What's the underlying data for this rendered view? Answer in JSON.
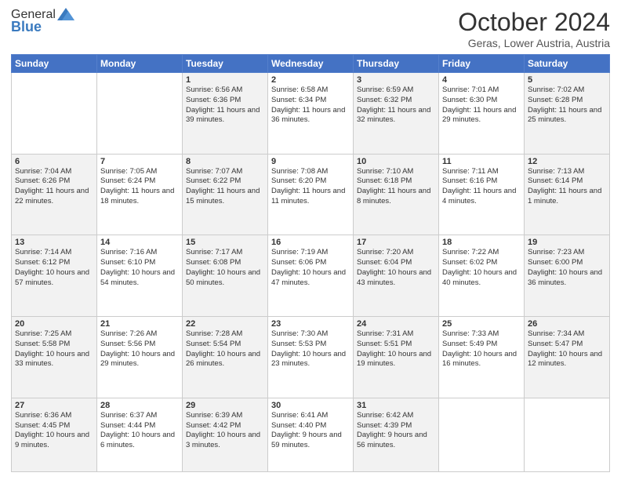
{
  "logo": {
    "general": "General",
    "blue": "Blue"
  },
  "header": {
    "month": "October 2024",
    "location": "Geras, Lower Austria, Austria"
  },
  "days_of_week": [
    "Sunday",
    "Monday",
    "Tuesday",
    "Wednesday",
    "Thursday",
    "Friday",
    "Saturday"
  ],
  "weeks": [
    [
      {
        "day": "",
        "info": ""
      },
      {
        "day": "",
        "info": ""
      },
      {
        "day": "1",
        "info": "Sunrise: 6:56 AM\nSunset: 6:36 PM\nDaylight: 11 hours and 39 minutes."
      },
      {
        "day": "2",
        "info": "Sunrise: 6:58 AM\nSunset: 6:34 PM\nDaylight: 11 hours and 36 minutes."
      },
      {
        "day": "3",
        "info": "Sunrise: 6:59 AM\nSunset: 6:32 PM\nDaylight: 11 hours and 32 minutes."
      },
      {
        "day": "4",
        "info": "Sunrise: 7:01 AM\nSunset: 6:30 PM\nDaylight: 11 hours and 29 minutes."
      },
      {
        "day": "5",
        "info": "Sunrise: 7:02 AM\nSunset: 6:28 PM\nDaylight: 11 hours and 25 minutes."
      }
    ],
    [
      {
        "day": "6",
        "info": "Sunrise: 7:04 AM\nSunset: 6:26 PM\nDaylight: 11 hours and 22 minutes."
      },
      {
        "day": "7",
        "info": "Sunrise: 7:05 AM\nSunset: 6:24 PM\nDaylight: 11 hours and 18 minutes."
      },
      {
        "day": "8",
        "info": "Sunrise: 7:07 AM\nSunset: 6:22 PM\nDaylight: 11 hours and 15 minutes."
      },
      {
        "day": "9",
        "info": "Sunrise: 7:08 AM\nSunset: 6:20 PM\nDaylight: 11 hours and 11 minutes."
      },
      {
        "day": "10",
        "info": "Sunrise: 7:10 AM\nSunset: 6:18 PM\nDaylight: 11 hours and 8 minutes."
      },
      {
        "day": "11",
        "info": "Sunrise: 7:11 AM\nSunset: 6:16 PM\nDaylight: 11 hours and 4 minutes."
      },
      {
        "day": "12",
        "info": "Sunrise: 7:13 AM\nSunset: 6:14 PM\nDaylight: 11 hours and 1 minute."
      }
    ],
    [
      {
        "day": "13",
        "info": "Sunrise: 7:14 AM\nSunset: 6:12 PM\nDaylight: 10 hours and 57 minutes."
      },
      {
        "day": "14",
        "info": "Sunrise: 7:16 AM\nSunset: 6:10 PM\nDaylight: 10 hours and 54 minutes."
      },
      {
        "day": "15",
        "info": "Sunrise: 7:17 AM\nSunset: 6:08 PM\nDaylight: 10 hours and 50 minutes."
      },
      {
        "day": "16",
        "info": "Sunrise: 7:19 AM\nSunset: 6:06 PM\nDaylight: 10 hours and 47 minutes."
      },
      {
        "day": "17",
        "info": "Sunrise: 7:20 AM\nSunset: 6:04 PM\nDaylight: 10 hours and 43 minutes."
      },
      {
        "day": "18",
        "info": "Sunrise: 7:22 AM\nSunset: 6:02 PM\nDaylight: 10 hours and 40 minutes."
      },
      {
        "day": "19",
        "info": "Sunrise: 7:23 AM\nSunset: 6:00 PM\nDaylight: 10 hours and 36 minutes."
      }
    ],
    [
      {
        "day": "20",
        "info": "Sunrise: 7:25 AM\nSunset: 5:58 PM\nDaylight: 10 hours and 33 minutes."
      },
      {
        "day": "21",
        "info": "Sunrise: 7:26 AM\nSunset: 5:56 PM\nDaylight: 10 hours and 29 minutes."
      },
      {
        "day": "22",
        "info": "Sunrise: 7:28 AM\nSunset: 5:54 PM\nDaylight: 10 hours and 26 minutes."
      },
      {
        "day": "23",
        "info": "Sunrise: 7:30 AM\nSunset: 5:53 PM\nDaylight: 10 hours and 23 minutes."
      },
      {
        "day": "24",
        "info": "Sunrise: 7:31 AM\nSunset: 5:51 PM\nDaylight: 10 hours and 19 minutes."
      },
      {
        "day": "25",
        "info": "Sunrise: 7:33 AM\nSunset: 5:49 PM\nDaylight: 10 hours and 16 minutes."
      },
      {
        "day": "26",
        "info": "Sunrise: 7:34 AM\nSunset: 5:47 PM\nDaylight: 10 hours and 12 minutes."
      }
    ],
    [
      {
        "day": "27",
        "info": "Sunrise: 6:36 AM\nSunset: 4:45 PM\nDaylight: 10 hours and 9 minutes."
      },
      {
        "day": "28",
        "info": "Sunrise: 6:37 AM\nSunset: 4:44 PM\nDaylight: 10 hours and 6 minutes."
      },
      {
        "day": "29",
        "info": "Sunrise: 6:39 AM\nSunset: 4:42 PM\nDaylight: 10 hours and 3 minutes."
      },
      {
        "day": "30",
        "info": "Sunrise: 6:41 AM\nSunset: 4:40 PM\nDaylight: 9 hours and 59 minutes."
      },
      {
        "day": "31",
        "info": "Sunrise: 6:42 AM\nSunset: 4:39 PM\nDaylight: 9 hours and 56 minutes."
      },
      {
        "day": "",
        "info": ""
      },
      {
        "day": "",
        "info": ""
      }
    ]
  ]
}
